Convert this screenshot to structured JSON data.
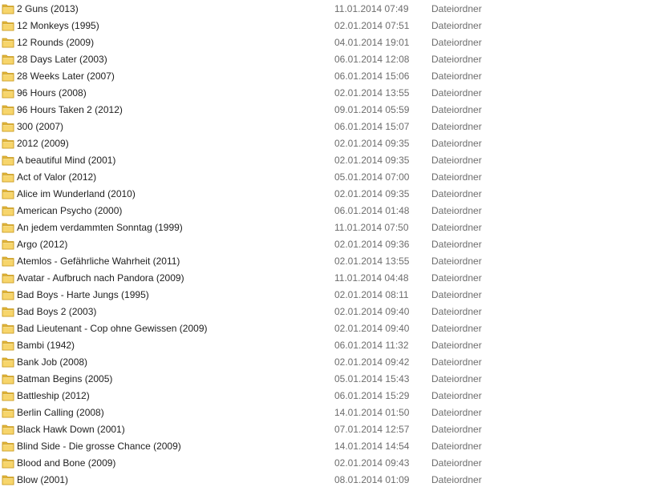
{
  "columns": [
    "name",
    "date_modified",
    "type"
  ],
  "folder_icon": "folder-icon",
  "colors": {
    "folder_front": "#f7d56b",
    "folder_back": "#e0b53c",
    "folder_edge": "#c99a1e",
    "text_primary": "#1e1e1e",
    "text_secondary": "#6d6d6d"
  },
  "rows": [
    {
      "name": "2 Guns (2013)",
      "date": "11.01.2014 07:49",
      "type": "Dateiordner"
    },
    {
      "name": "12 Monkeys (1995)",
      "date": "02.01.2014 07:51",
      "type": "Dateiordner"
    },
    {
      "name": "12 Rounds (2009)",
      "date": "04.01.2014 19:01",
      "type": "Dateiordner"
    },
    {
      "name": "28 Days Later (2003)",
      "date": "06.01.2014 12:08",
      "type": "Dateiordner"
    },
    {
      "name": "28 Weeks Later (2007)",
      "date": "06.01.2014 15:06",
      "type": "Dateiordner"
    },
    {
      "name": "96 Hours (2008)",
      "date": "02.01.2014 13:55",
      "type": "Dateiordner"
    },
    {
      "name": "96 Hours Taken 2 (2012)",
      "date": "09.01.2014 05:59",
      "type": "Dateiordner"
    },
    {
      "name": "300 (2007)",
      "date": "06.01.2014 15:07",
      "type": "Dateiordner"
    },
    {
      "name": "2012 (2009)",
      "date": "02.01.2014 09:35",
      "type": "Dateiordner"
    },
    {
      "name": "A beautiful Mind (2001)",
      "date": "02.01.2014 09:35",
      "type": "Dateiordner"
    },
    {
      "name": "Act of Valor (2012)",
      "date": "05.01.2014 07:00",
      "type": "Dateiordner"
    },
    {
      "name": "Alice im Wunderland (2010)",
      "date": "02.01.2014 09:35",
      "type": "Dateiordner"
    },
    {
      "name": "American Psycho (2000)",
      "date": "06.01.2014 01:48",
      "type": "Dateiordner"
    },
    {
      "name": "An jedem verdammten Sonntag (1999)",
      "date": "11.01.2014 07:50",
      "type": "Dateiordner"
    },
    {
      "name": "Argo (2012)",
      "date": "02.01.2014 09:36",
      "type": "Dateiordner"
    },
    {
      "name": "Atemlos - Gefährliche Wahrheit (2011)",
      "date": "02.01.2014 13:55",
      "type": "Dateiordner"
    },
    {
      "name": "Avatar - Aufbruch nach Pandora (2009)",
      "date": "11.01.2014 04:48",
      "type": "Dateiordner"
    },
    {
      "name": "Bad Boys - Harte Jungs (1995)",
      "date": "02.01.2014 08:11",
      "type": "Dateiordner"
    },
    {
      "name": "Bad Boys 2 (2003)",
      "date": "02.01.2014 09:40",
      "type": "Dateiordner"
    },
    {
      "name": "Bad Lieutenant - Cop ohne Gewissen (2009)",
      "date": "02.01.2014 09:40",
      "type": "Dateiordner"
    },
    {
      "name": "Bambi (1942)",
      "date": "06.01.2014 11:32",
      "type": "Dateiordner"
    },
    {
      "name": "Bank Job (2008)",
      "date": "02.01.2014 09:42",
      "type": "Dateiordner"
    },
    {
      "name": "Batman Begins (2005)",
      "date": "05.01.2014 15:43",
      "type": "Dateiordner"
    },
    {
      "name": "Battleship (2012)",
      "date": "06.01.2014 15:29",
      "type": "Dateiordner"
    },
    {
      "name": "Berlin Calling (2008)",
      "date": "14.01.2014 01:50",
      "type": "Dateiordner"
    },
    {
      "name": "Black Hawk Down (2001)",
      "date": "07.01.2014 12:57",
      "type": "Dateiordner"
    },
    {
      "name": "Blind Side - Die grosse Chance (2009)",
      "date": "14.01.2014 14:54",
      "type": "Dateiordner"
    },
    {
      "name": "Blood and Bone (2009)",
      "date": "02.01.2014 09:43",
      "type": "Dateiordner"
    },
    {
      "name": "Blow (2001)",
      "date": "08.01.2014 01:09",
      "type": "Dateiordner"
    }
  ]
}
